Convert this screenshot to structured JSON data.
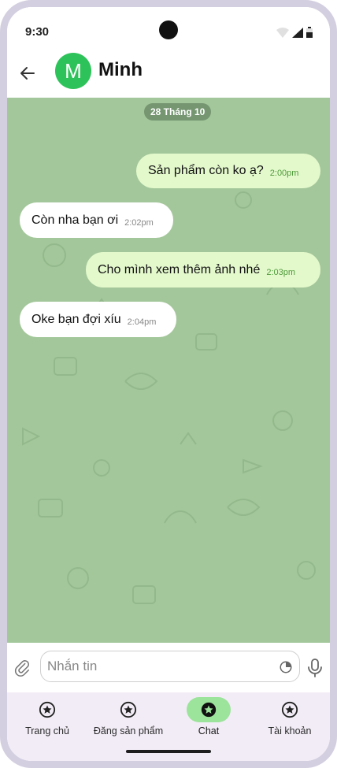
{
  "status": {
    "time": "9:30"
  },
  "header": {
    "avatar_letter": "M",
    "contact_name": "Minh"
  },
  "chat": {
    "date_label": "28 Tháng 10",
    "messages": [
      {
        "text": "Sản phẩm còn ko ạ?",
        "time": "2:00pm",
        "direction": "outgoing"
      },
      {
        "text": "Còn nha bạn ơi",
        "time": "2:02pm",
        "direction": "incoming"
      },
      {
        "text": "Cho mình xem thêm ảnh nhé",
        "time": "2:03pm",
        "direction": "outgoing"
      },
      {
        "text": "Oke bạn đợi xíu",
        "time": "2:04pm",
        "direction": "incoming"
      }
    ]
  },
  "composer": {
    "placeholder": "Nhắn tin"
  },
  "nav": {
    "items": [
      {
        "label": "Trang chủ",
        "icon": "star-circle-icon"
      },
      {
        "label": "Đăng sản phẩm",
        "icon": "star-circle-icon"
      },
      {
        "label": "Chat",
        "icon": "star-circle-icon",
        "active": true
      },
      {
        "label": "Tài khoản",
        "icon": "star-circle-icon"
      }
    ]
  },
  "colors": {
    "chat_background": "#a3c79a",
    "outgoing_bubble": "#e3f9cc",
    "incoming_bubble": "#ffffff",
    "avatar": "#2ec35a",
    "active_nav": "#9ce39b",
    "nav_background": "#f2ecf6"
  }
}
